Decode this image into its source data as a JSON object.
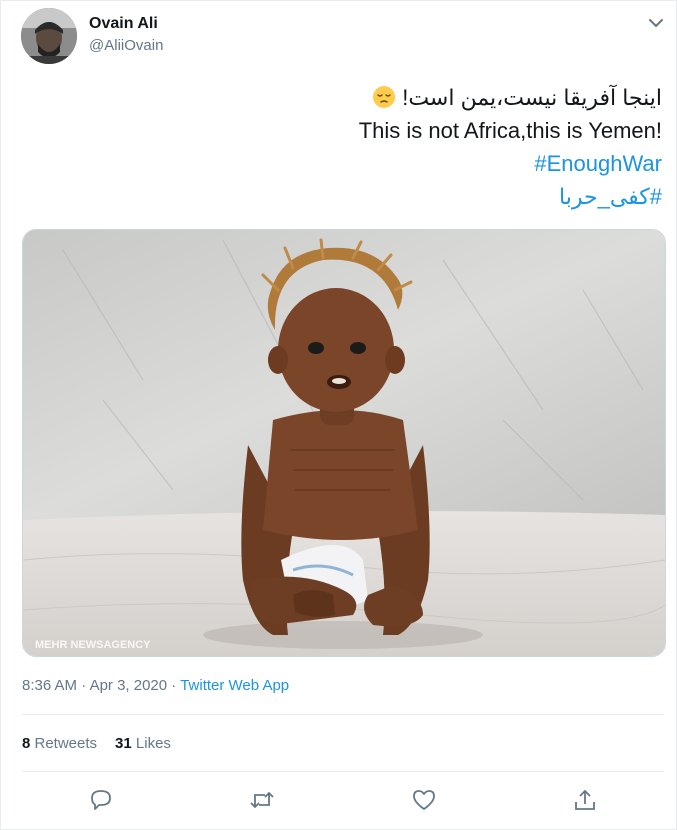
{
  "author": {
    "name": "Ovain Ali",
    "handle": "@AliiOvain",
    "avatar_icon": "avatar-photo"
  },
  "tweet": {
    "line_persian": "اینجا آفریقا نیست،یمن است!",
    "line_english": "This is not Africa,this is Yemen!",
    "hashtag_1": "#EnoughWar",
    "hashtag_2": "#کفی_حربا",
    "emoji": "pensive-face"
  },
  "media": {
    "watermark": "MEHR NEWSAGENCY"
  },
  "meta": {
    "time": "8:36 AM",
    "separator": " · ",
    "date": "Apr 3, 2020",
    "separator2": " · ",
    "source": "Twitter Web App"
  },
  "stats": {
    "retweets_count": "8",
    "retweets_label": " Retweets",
    "likes_count": "31",
    "likes_label": " Likes"
  },
  "actions": [
    "reply-icon",
    "retweet-icon",
    "like-icon",
    "share-icon"
  ],
  "colors": {
    "link": "#1b95e0",
    "muted": "#657786",
    "text": "#14171a",
    "border": "#e6ecf0"
  }
}
